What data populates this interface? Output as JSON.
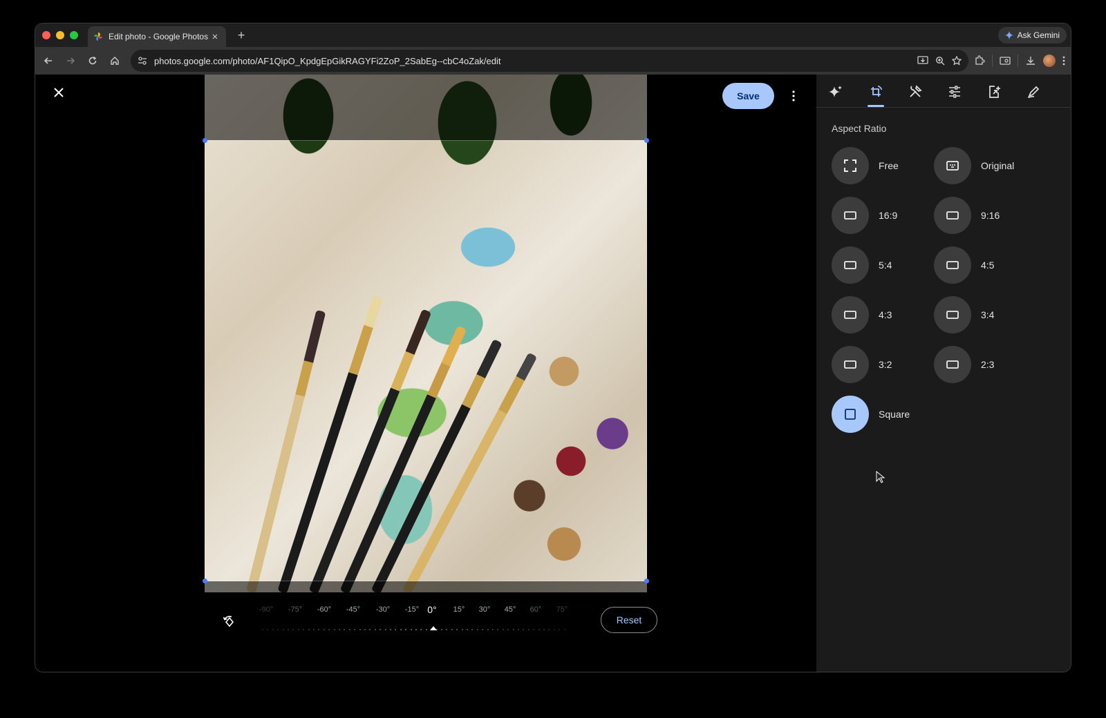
{
  "browser": {
    "tab_title": "Edit photo - Google Photos",
    "tab_close": "×",
    "new_tab": "+",
    "gemini_label": "Ask Gemini",
    "url": "photos.google.com/photo/AF1QipO_KpdgEpGikRAGYFi2ZoP_2SabEg--cbC4oZak/edit"
  },
  "editor": {
    "save_label": "Save",
    "reset_label": "Reset",
    "dial": {
      "labels": [
        "-90°",
        "-75°",
        "-60°",
        "-45°",
        "-30°",
        "-15°",
        "0°",
        "15°",
        "30°",
        "45°",
        "60°",
        "75°"
      ],
      "current": "0°"
    }
  },
  "panel": {
    "tabs": [
      "auto-enhance",
      "crop-rotate",
      "tools",
      "adjust",
      "export",
      "markup"
    ],
    "active_tab": "crop-rotate",
    "section_title": "Aspect Ratio",
    "aspect_ratios": [
      {
        "label": "Free",
        "icon": "free-crop-icon"
      },
      {
        "label": "Original",
        "icon": "original-ratio-icon"
      },
      {
        "label": "16:9",
        "icon": "rectangle-icon"
      },
      {
        "label": "9:16",
        "icon": "rectangle-icon"
      },
      {
        "label": "5:4",
        "icon": "rectangle-icon"
      },
      {
        "label": "4:5",
        "icon": "rectangle-icon"
      },
      {
        "label": "4:3",
        "icon": "rectangle-icon"
      },
      {
        "label": "3:4",
        "icon": "rectangle-icon"
      },
      {
        "label": "3:2",
        "icon": "rectangle-icon"
      },
      {
        "label": "2:3",
        "icon": "rectangle-icon"
      },
      {
        "label": "Square",
        "icon": "square-icon",
        "selected": true
      }
    ]
  },
  "colors": {
    "accent": "#a8c7fa",
    "panel_bg": "#1b1b1b",
    "handle": "#4a7dff"
  }
}
